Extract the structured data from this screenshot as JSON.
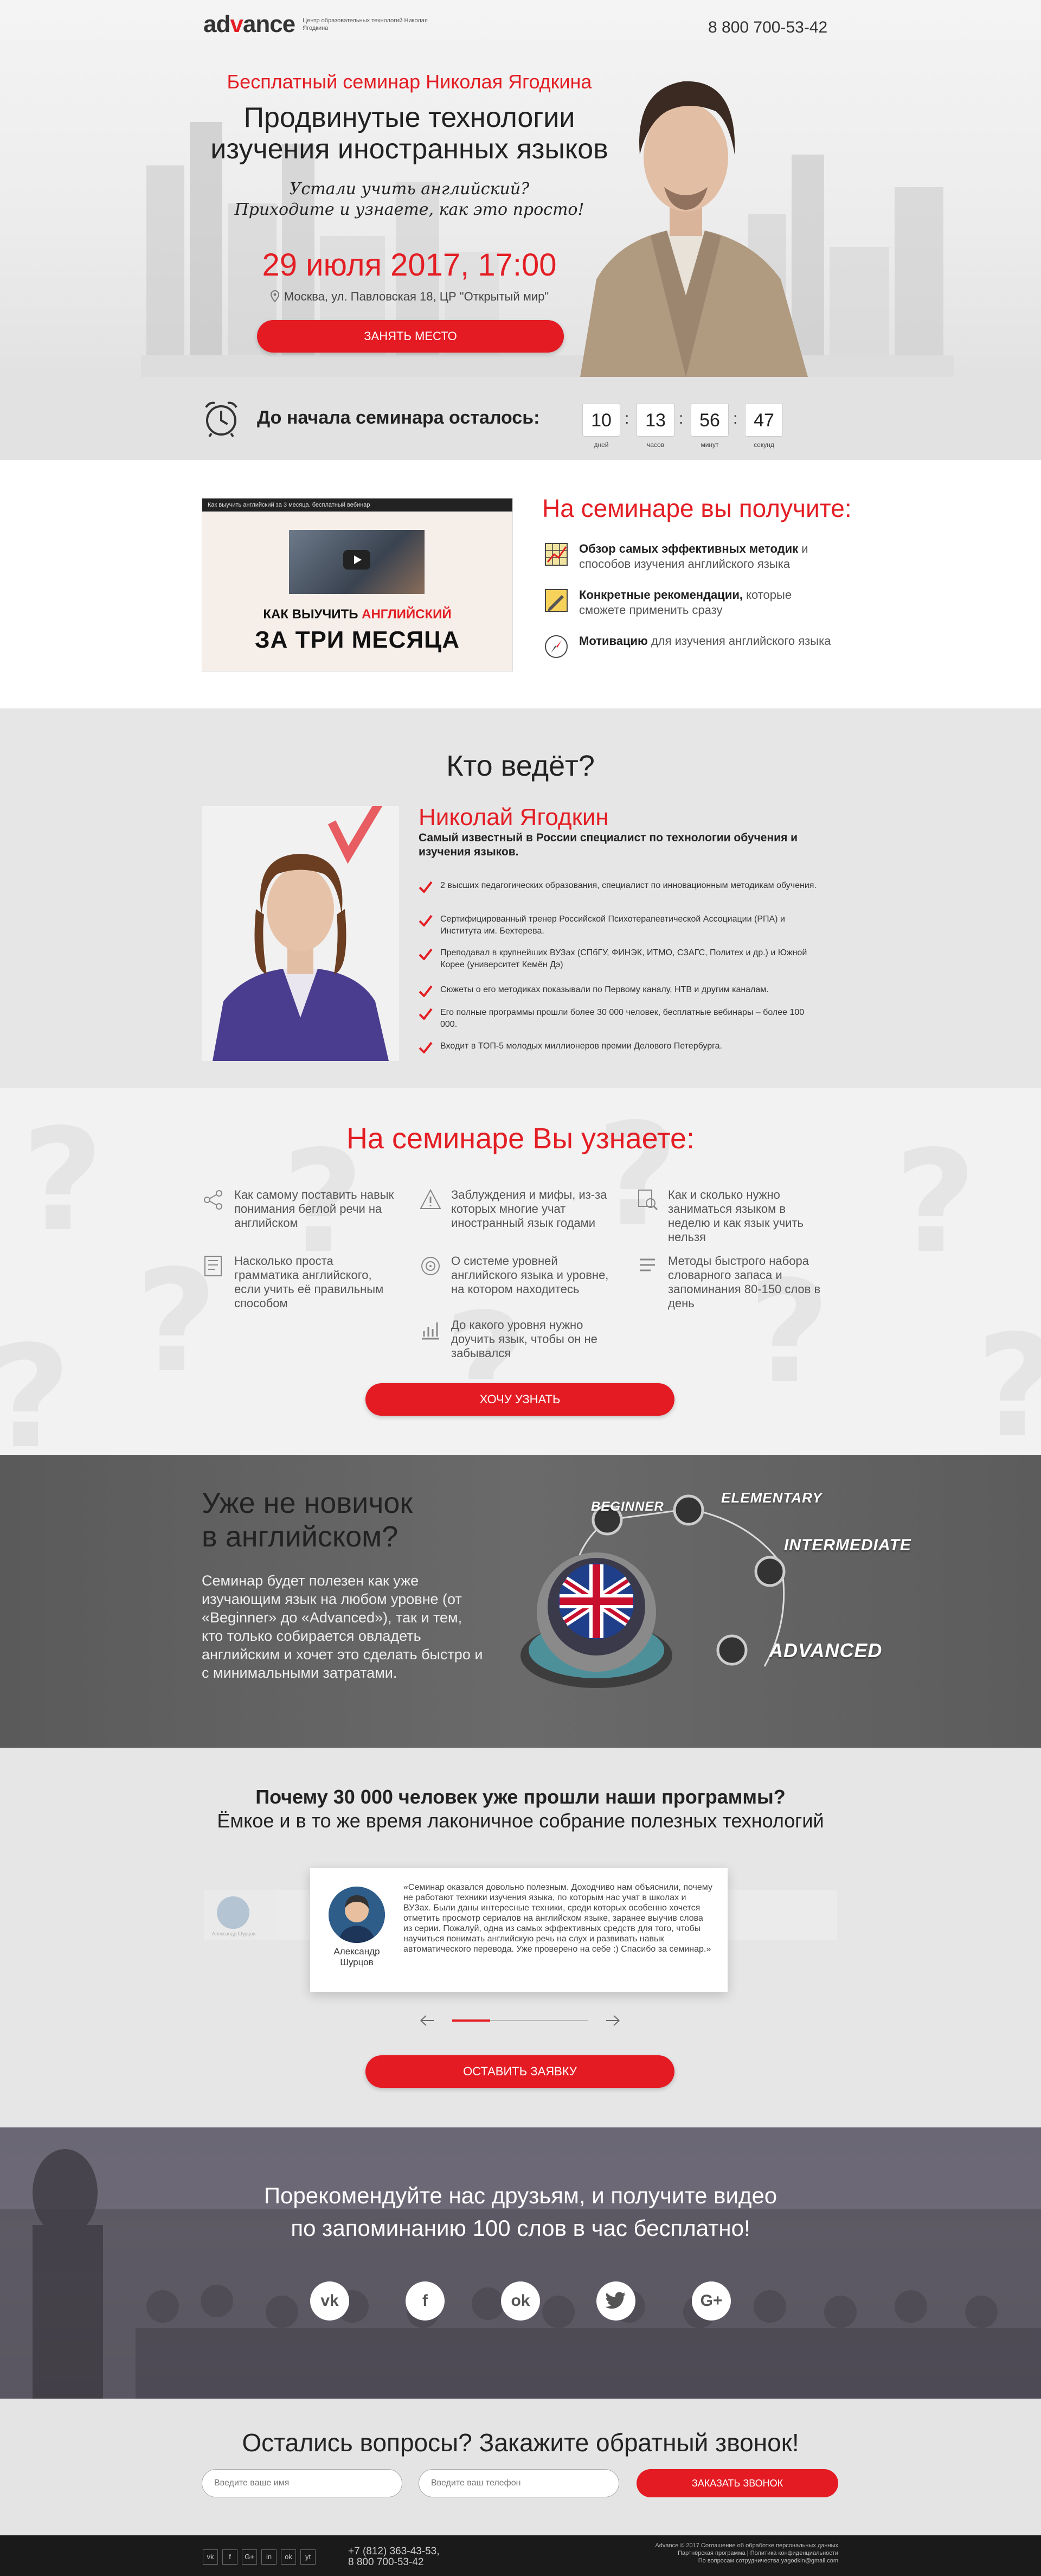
{
  "header": {
    "logo_text_1": "ad",
    "logo_text_2": "v",
    "logo_text_3": "ance",
    "logo_desc": "Центр образовательных технологий Николая Ягодкина",
    "phone": "8 800 700-53-42"
  },
  "hero": {
    "subtitle": "Бесплатный семинар Николая Ягодкина",
    "title_line1": "Продвинутые технологии",
    "title_line2": "изучения иностранных языков",
    "hand_line1": "Устали учить английский?",
    "hand_line2": "Приходите и узнаете, как это просто!",
    "date": "29 июля 2017,",
    "time": "17:00",
    "address": "Москва, ул. Павловская 18, ЦР \"Открытый мир\"",
    "button": "ЗАНЯТЬ МЕСТО"
  },
  "countdown": {
    "label": "До начала семинара осталось:",
    "days": "10",
    "hours": "13",
    "minutes": "56",
    "seconds": "47",
    "days_label": "дней",
    "hours_label": "часов",
    "minutes_label": "минут",
    "seconds_label": "секунд"
  },
  "get": {
    "video_title": "Как выучить английский за 3 месяца. бесплатный вебинар",
    "video_line1a": "КАК ВЫУЧИТЬ",
    "video_line1b": "АНГЛИЙСКИЙ",
    "video_line2": "ЗА ТРИ МЕСЯЦА",
    "title": "На семинаре вы получите:",
    "items": [
      {
        "bold": "Обзор самых эффективных методик",
        "rest": " и способов изучения английского языка"
      },
      {
        "bold": "Конкретные рекомендации,",
        "rest": " которые сможете применить сразу"
      },
      {
        "bold": "Мотивацию",
        "rest": " для изучения английского языка"
      }
    ]
  },
  "who": {
    "title": "Кто ведёт?",
    "name": "Николай Ягодкин",
    "desc": "Самый известный в России специалист по технологии обучения и изучения языков.",
    "items": [
      "2 высших педагогических образования, специалист по инновационным методикам обучения.",
      "Сертифицированный тренер Российской Психотерапевтической Ассоциации (РПА) и Института им. Бехтерева.",
      "Преподавал в крупнейших ВУЗах (СПбГУ, ФИНЭК, ИТМО, СЗАГС, Политех и др.) и Южной Корее (университет Кемён Дэ)",
      "Сюжеты о его методиках показывали по Первому каналу, НТВ и другим каналам.",
      "Его полные программы прошли более 30 000 человек, бесплатные вебинары – более 100 000.",
      "Входит в ТОП-5 молодых миллионеров премии Делового Петербурга."
    ]
  },
  "learn": {
    "title": "На семинаре Вы узнаете:",
    "items": [
      "Как самому поставить навык понимания беглой речи на английском",
      "Заблуждения и мифы, из-за которых многие учат иностранный язык годами",
      "Как и сколько нужно заниматься языком в неделю и как язык учить нельзя",
      "Насколько проста грамматика английского, если учить её правильным способом",
      "О системе уровней английского языка и уровне, на котором находитесь",
      "Методы быстрого набора словарного запаса и запоминания 80-150 слов в день",
      "До какого уровня нужно доучить язык, чтобы он не забывался"
    ],
    "button": "ХОЧУ УЗНАТЬ"
  },
  "level": {
    "title_line1": "Уже не новичок",
    "title_line2": "в английском?",
    "text": "Семинар будет полезен как уже изучающим язык на любом уровне (от «Beginner» до «Advanced»), так и тем, кто только собирается овладеть английским и хочет это сделать быстро и с минимальными затратами.",
    "levels": [
      "BEGINNER",
      "ELEMENTARY",
      "INTERMEDIATE",
      "ADVANCED"
    ]
  },
  "reviews": {
    "title": "Почему 30 000 человек уже прошли наши программы?",
    "subtitle": "Ёмкое и в то же время лаконичное собрание полезных технологий",
    "name": "Александр Шурцов",
    "side_name": "Александр Шурцов",
    "text": "«Семинар оказался довольно полезным. Доходчиво нам объяснили, почему не работают техники изучения языка, по которым нас учат в школах и ВУЗах. Были даны интересные техники, среди которых особенно хочется отметить просмотр сериалов на английском языке, заранее выучив слова из серии. Пожалуй, одна из самых эффективных средств для того, чтобы научиться понимать английскую речь на слух и развивать навык автоматического перевода. Уже проверено на себе :) Спасибо за семинар.»",
    "button": "ОСТАВИТЬ ЗАЯВКУ"
  },
  "share": {
    "title_line1": "Порекомендуйте нас друзьям, и получите видео",
    "title_line2": "по запоминанию 100 слов в час бесплатно!",
    "networks": [
      "vk",
      "f",
      "ok",
      "twitter",
      "G+"
    ]
  },
  "callback": {
    "title": "Остались вопросы? Закажите обратный звонок!",
    "name_placeholder": "Введите ваше имя",
    "phone_placeholder": "Введите ваш телефон",
    "button": "ЗАКАЗАТЬ ЗВОНОК"
  },
  "footer": {
    "phone1": "+7 (812) 363-43-53,",
    "phone2": "8 800 700-53-42",
    "legal1": "Advance © 2017 Соглашение об обработке персональных данных",
    "legal2": "Партнёрская программа | Политика конфиденциальности",
    "legal3": "По вопросам сотрудничества yagodkin@gmail.com",
    "social": [
      "vk",
      "f",
      "G+",
      "in",
      "ok",
      "yt"
    ]
  }
}
